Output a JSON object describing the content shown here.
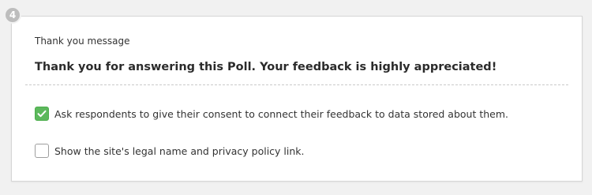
{
  "step": {
    "number": "4"
  },
  "thank_you": {
    "label": "Thank you message",
    "message": "Thank you for answering this Poll. Your feedback is highly appreciated!"
  },
  "options": [
    {
      "label": "Ask respondents to give their consent to connect their feedback to data stored about them.",
      "checked": true
    },
    {
      "label": "Show the site's legal name and privacy policy link.",
      "checked": false
    }
  ],
  "colors": {
    "checked_green": "#5cb85c",
    "badge_gray": "#bdbdbd",
    "background": "#f1f1f1"
  }
}
